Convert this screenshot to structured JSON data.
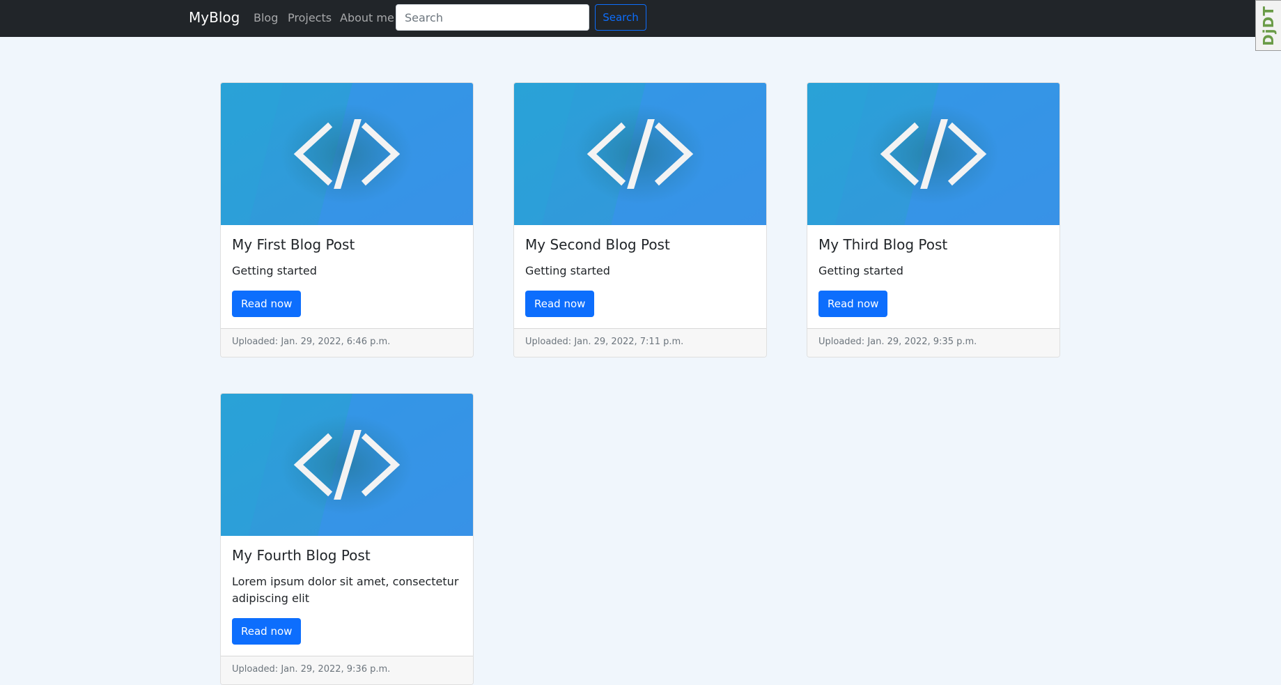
{
  "nav": {
    "brand": "MyBlog",
    "links": [
      "Blog",
      "Projects",
      "About me"
    ],
    "search_placeholder": "Search",
    "search_button": "Search"
  },
  "debug_toolbar": {
    "label": "DjDT"
  },
  "posts": [
    {
      "title": "My First Blog Post",
      "description": "Getting started",
      "button": "Read now",
      "uploaded": "Uploaded: Jan. 29, 2022, 6:46 p.m."
    },
    {
      "title": "My Second Blog Post",
      "description": "Getting started",
      "button": "Read now",
      "uploaded": "Uploaded: Jan. 29, 2022, 7:11 p.m."
    },
    {
      "title": "My Third Blog Post",
      "description": "Getting started",
      "button": "Read now",
      "uploaded": "Uploaded: Jan. 29, 2022, 9:35 p.m."
    },
    {
      "title": "My Fourth Blog Post",
      "description": "Lorem ipsum dolor sit amet, consectetur adipiscing elit",
      "button": "Read now",
      "uploaded": "Uploaded: Jan. 29, 2022, 9:36 p.m."
    }
  ],
  "colors": {
    "navbar": "#212529",
    "page_background": "#f0f6fc",
    "primary": "#0d6efd",
    "thumbnail_blue": "#2f93e6"
  },
  "icons": {
    "post_thumbnail": "code-brackets-icon"
  }
}
